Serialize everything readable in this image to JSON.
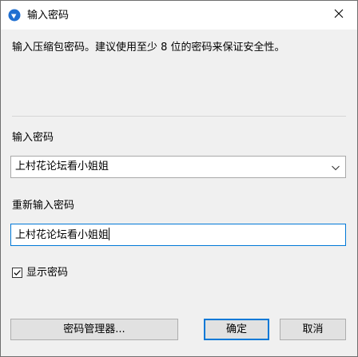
{
  "window": {
    "title": "输入密码",
    "app_icon": "7zip-style-blue-circle-icon",
    "close_icon": "close-icon"
  },
  "info": {
    "text": "输入压缩包密码。建议使用至少 8 位的密码来保证安全性。"
  },
  "password": {
    "label": "输入密码",
    "value": "上村花论坛看小姐姐",
    "dropdown_icon": "chevron-down-icon"
  },
  "confirm": {
    "label": "重新输入密码",
    "value": "上村花论坛看小姐姐"
  },
  "show_password": {
    "label": "显示密码",
    "checked": true
  },
  "buttons": {
    "manager": "密码管理器...",
    "ok": "确定",
    "cancel": "取消"
  },
  "colors": {
    "accent": "#0078d7",
    "dialog_bg": "#f0f0f0",
    "button_bg": "#e1e1e1"
  }
}
